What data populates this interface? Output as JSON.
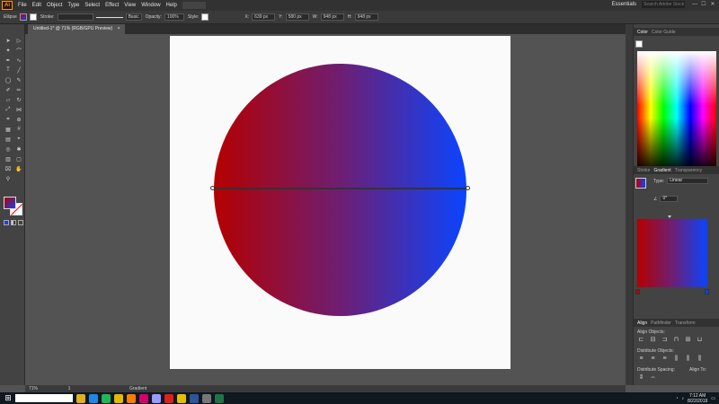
{
  "app": {
    "logo": "Ai"
  },
  "menu": [
    "File",
    "Edit",
    "Object",
    "Type",
    "Select",
    "Effect",
    "View",
    "Window",
    "Help"
  ],
  "window": {
    "workspace": "Essentials",
    "search_placeholder": "Search Adobe Stock",
    "minimize": "—",
    "maximize": "☐",
    "close": "✕"
  },
  "control": {
    "selection": "Ellipse",
    "stroke_label": "Stroke:",
    "stroke_style": "Basic",
    "opacity_label": "Opacity:",
    "opacity": "100%",
    "style_label": "Style:",
    "x": "639 px",
    "y": "580 px",
    "w": "948 px",
    "h": "948 px"
  },
  "document": {
    "tab_title": "Untitled-1* @ 71% (RGB/GPU Preview)",
    "close": "×"
  },
  "status": {
    "zoom": "71%",
    "page": "1",
    "tool": "Gradient"
  },
  "panels": {
    "color": {
      "tabs": [
        "Color",
        "Color Guide"
      ]
    },
    "gradient": {
      "tabs": [
        "Stroke",
        "Gradient",
        "Transparency"
      ],
      "type_label": "Type:",
      "type": "Linear",
      "angle": "0°",
      "stop_colors": [
        "#b50000",
        "#0a44ff"
      ]
    },
    "align": {
      "tabs": [
        "Align",
        "Pathfinder",
        "Transform"
      ],
      "align_objects": "Align Objects:",
      "distribute_objects": "Distribute Objects:",
      "distribute_spacing": "Distribute Spacing:",
      "align_to": "Align To:"
    }
  },
  "canvas": {
    "gradient_start": "#b50000",
    "gradient_mid": "#6e1e72",
    "gradient_end": "#0a44ff"
  },
  "taskbar": {
    "time": "7:12 AM",
    "date": "8/22/2019",
    "apps": [
      {
        "name": "chrome-icon",
        "color": "#e0b020"
      },
      {
        "name": "edge-icon",
        "color": "#1e88e5"
      },
      {
        "name": "spotify-icon",
        "color": "#1db954"
      },
      {
        "name": "folder-icon",
        "color": "#e6b800"
      },
      {
        "name": "illustrator-icon",
        "color": "#ff7c00"
      },
      {
        "name": "indesign-icon",
        "color": "#d6006f"
      },
      {
        "name": "premiere-icon",
        "color": "#9999ff"
      },
      {
        "name": "acrobat-icon",
        "color": "#e0201a"
      },
      {
        "name": "explorer-icon",
        "color": "#e6c000"
      },
      {
        "name": "word-icon",
        "color": "#2b579a"
      },
      {
        "name": "calc-icon",
        "color": "#777777"
      },
      {
        "name": "excel-icon",
        "color": "#217346"
      }
    ]
  }
}
